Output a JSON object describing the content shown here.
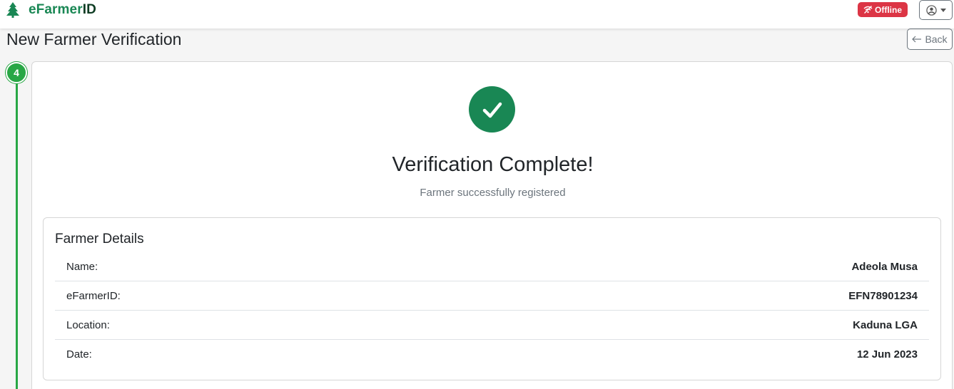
{
  "navbar": {
    "brand_prefix": "eFarmer",
    "brand_suffix": "ID",
    "offline_label": "Offline"
  },
  "header": {
    "title": "New Farmer Verification",
    "back_label": "Back"
  },
  "stepper": {
    "current_step": "4"
  },
  "result": {
    "heading": "Verification Complete!",
    "subheading": "Farmer successfully registered"
  },
  "details": {
    "title": "Farmer Details",
    "rows": [
      {
        "label": "Name:",
        "value": "Adeola Musa"
      },
      {
        "label": "eFarmerID:",
        "value": "EFN78901234"
      },
      {
        "label": "Location:",
        "value": "Kaduna LGA"
      },
      {
        "label": "Date:",
        "value": "12 Jun 2023"
      }
    ]
  },
  "icons": {
    "brand": "tree-icon",
    "offline": "wifi-off-icon",
    "user": "user-circle-icon",
    "back": "arrow-left-icon",
    "success": "check-circle-icon"
  },
  "colors": {
    "brand_green": "#198754",
    "step_green": "#28a745",
    "danger": "#dc3545",
    "muted": "#6c757d"
  }
}
